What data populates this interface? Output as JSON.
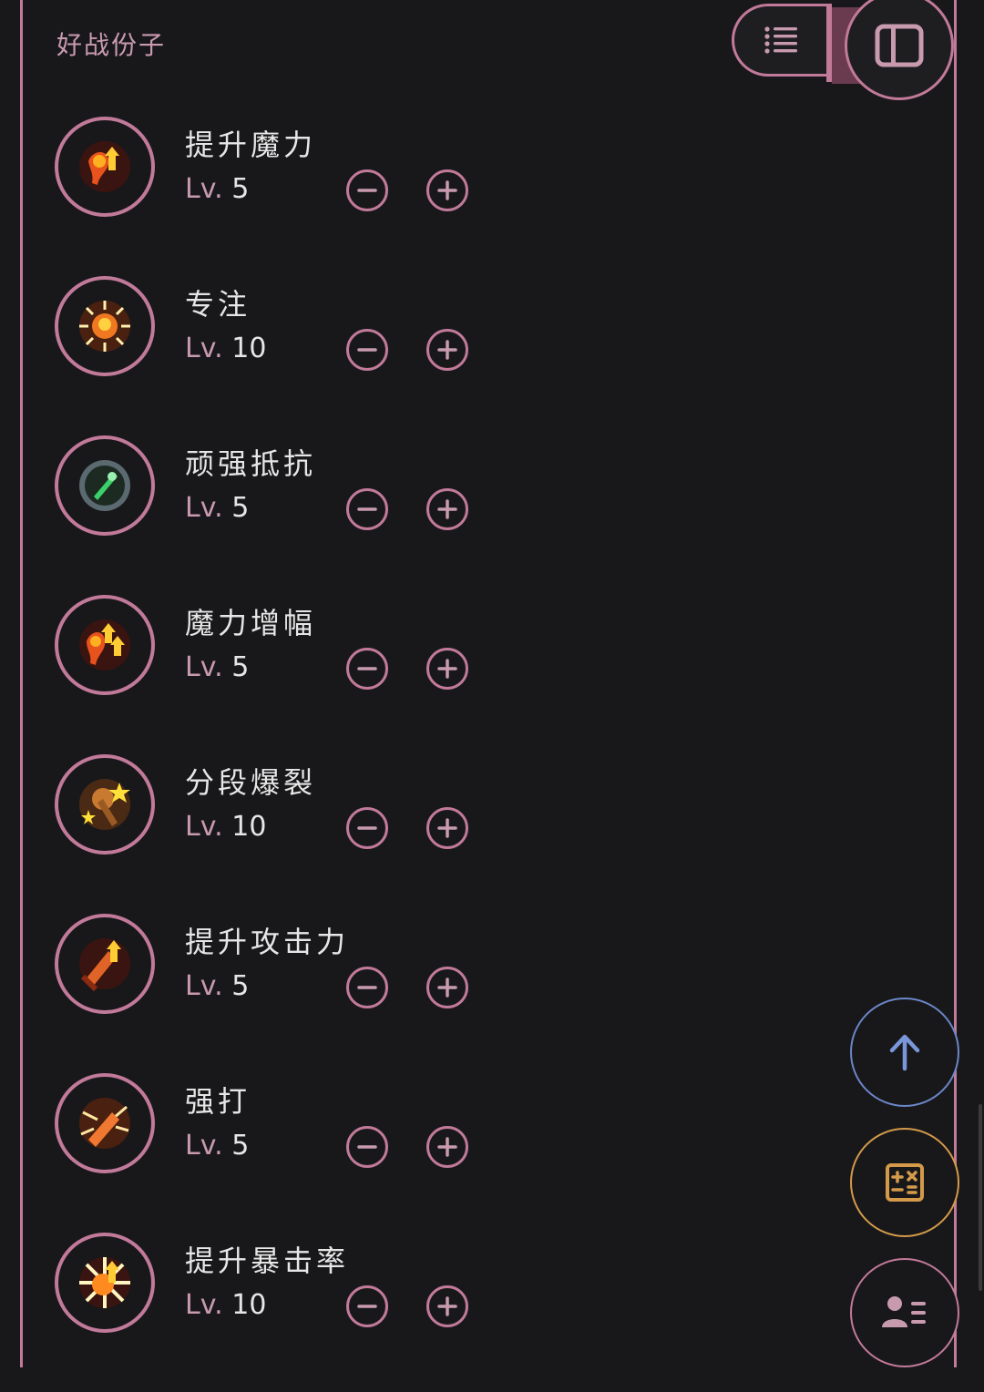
{
  "header": {
    "section_title": "好战份子"
  },
  "toolbar": {
    "list_view_icon": "list-icon",
    "panel_view_icon": "sidebar-panel-icon"
  },
  "skills": [
    {
      "name": "提升魔力",
      "lv_prefix": "Lv.",
      "level": "5",
      "icon": "magic-up-icon"
    },
    {
      "name": "专注",
      "lv_prefix": "Lv.",
      "level": "10",
      "icon": "focus-icon"
    },
    {
      "name": "顽强抵抗",
      "lv_prefix": "Lv.",
      "level": "5",
      "icon": "resist-icon"
    },
    {
      "name": "魔力增幅",
      "lv_prefix": "Lv.",
      "level": "5",
      "icon": "magic-amplify-icon"
    },
    {
      "name": "分段爆裂",
      "lv_prefix": "Lv.",
      "level": "10",
      "icon": "burst-icon"
    },
    {
      "name": "提升攻击力",
      "lv_prefix": "Lv.",
      "level": "5",
      "icon": "attack-up-icon"
    },
    {
      "name": "强打",
      "lv_prefix": "Lv.",
      "level": "5",
      "icon": "strike-icon"
    },
    {
      "name": "提升暴击率",
      "lv_prefix": "Lv.",
      "level": "10",
      "icon": "crit-up-icon"
    }
  ],
  "fabs": {
    "scroll_top_icon": "arrow-up-icon",
    "calculator_icon": "calculator-icon",
    "profile_icon": "profile-list-icon"
  },
  "colors": {
    "accent_pink": "#c27a9a",
    "background": "#18181a",
    "fab_blue": "#6b86c8",
    "fab_orange": "#d49a4a"
  }
}
